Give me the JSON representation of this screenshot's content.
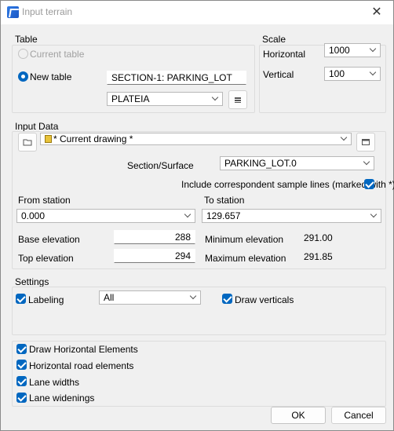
{
  "window": {
    "title": "Input terrain",
    "close_glyph": "✕"
  },
  "table_group": {
    "label": "Table",
    "current_table_label": "Current table",
    "new_table_label": "New table",
    "name_value": "SECTION-1: PARKING_LOT",
    "layer_value": "PLATEIA"
  },
  "scale_group": {
    "label": "Scale",
    "horizontal_label": "Horizontal",
    "horizontal_value": "1000",
    "vertical_label": "Vertical",
    "vertical_value": "100"
  },
  "input_group": {
    "label": "Input Data",
    "drawing_value": "* Current drawing *",
    "section_label": "Section/Surface",
    "section_value": "PARKING_LOT.0",
    "include_label": "Include correspondent sample lines (marked with *)",
    "from_label": "From station",
    "from_value": "0.000",
    "to_label": "To station",
    "to_value": "129.657",
    "base_label": "Base elevation",
    "base_value": "288",
    "top_label": "Top elevation",
    "top_value": "294",
    "min_label": "Minimum elevation",
    "min_value": "291.00",
    "max_label": "Maximum elevation",
    "max_value": "291.85"
  },
  "settings_group": {
    "label": "Settings",
    "labeling_label": "Labeling",
    "labeling_value": "All",
    "draw_verticals_label": "Draw verticals"
  },
  "options": {
    "draw_horizontal": "Draw Horizontal Elements",
    "horizontal_road": "Horizontal road elements",
    "lane_widths": "Lane widths",
    "lane_widenings": "Lane widenings"
  },
  "buttons": {
    "ok": "OK",
    "cancel": "Cancel"
  },
  "colors": {
    "accent": "#0067c0",
    "window_bg": "#f0f0f0",
    "title_text": "#9a9a9a"
  }
}
